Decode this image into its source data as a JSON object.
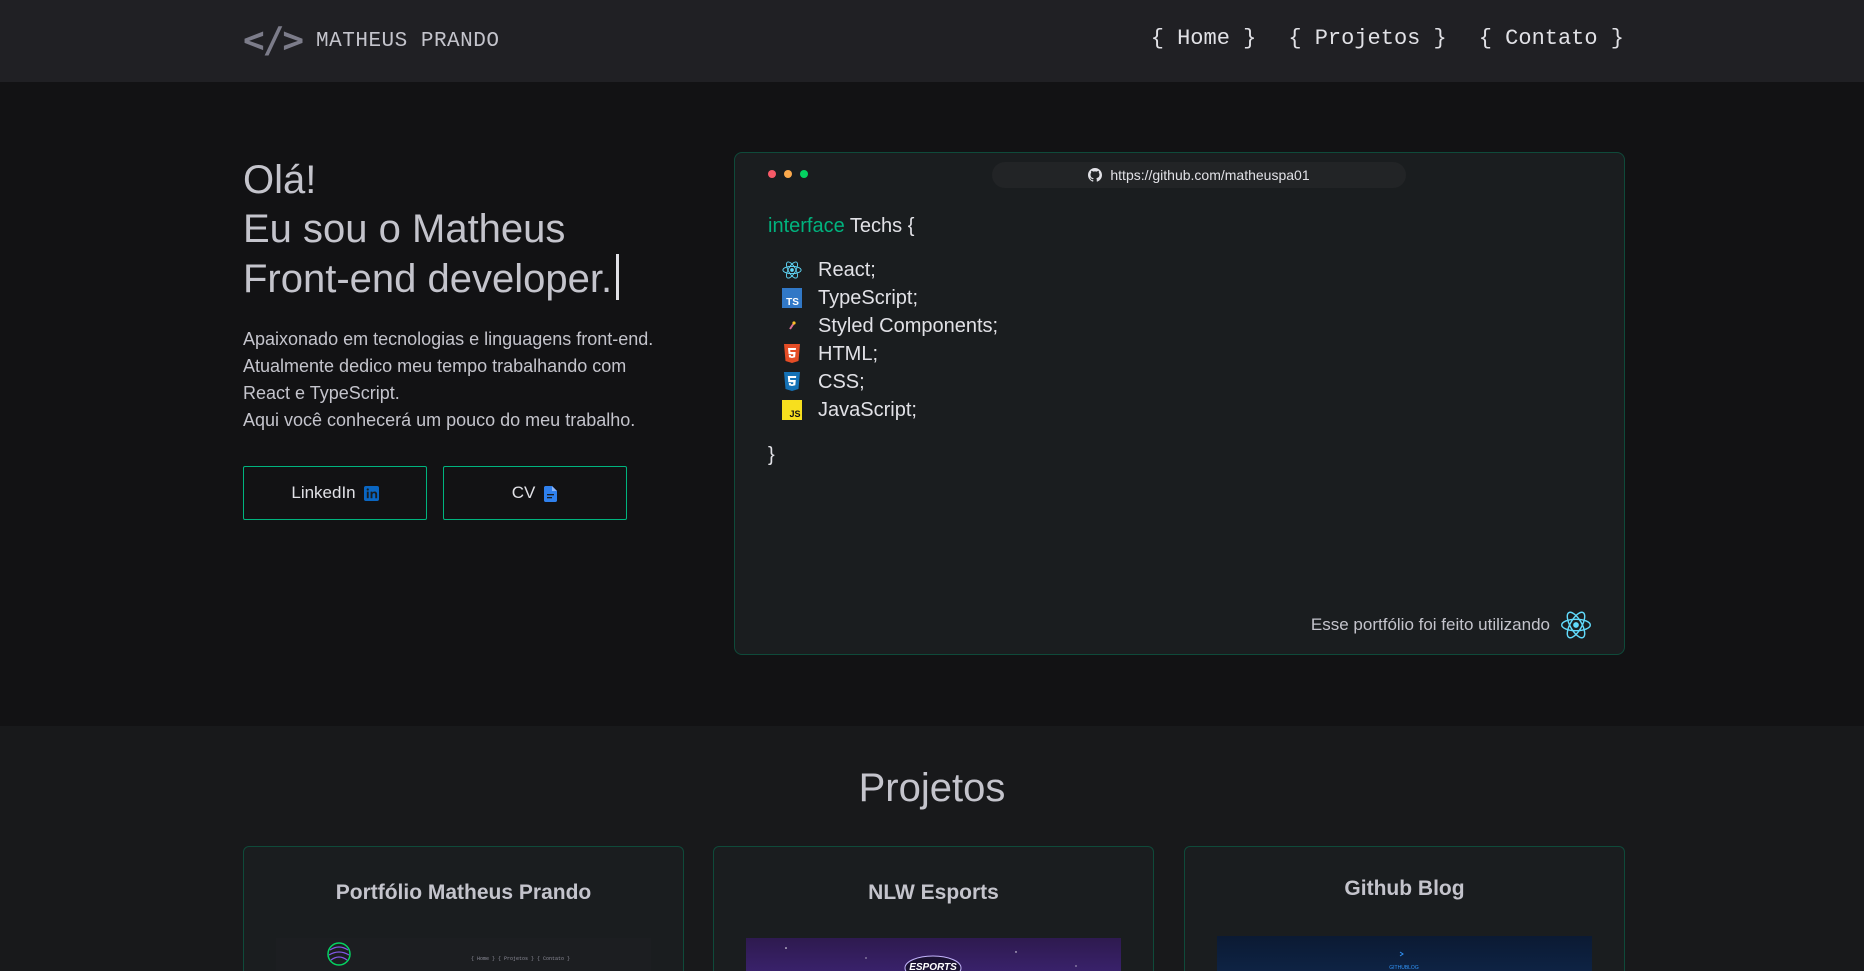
{
  "header": {
    "logo_mark": "</>",
    "name": "MATHEUS PRANDO",
    "nav": [
      "{ Home }",
      "{ Projetos }",
      "{ Contato }"
    ]
  },
  "hero": {
    "greeting": "Olá!",
    "line2": "Eu sou o Matheus",
    "line3": "Front-end developer.",
    "description": [
      "Apaixonado em tecnologias e linguagens front-end.",
      "Atualmente dedico meu tempo trabalhando com",
      "React e TypeScript.",
      "Aqui você conhecerá um pouco do meu trabalho."
    ],
    "buttons": {
      "linkedin": "LinkedIn",
      "cv": "CV"
    }
  },
  "code_card": {
    "url": "https://github.com/matheuspa01",
    "keyword": "interface",
    "type_name": "Techs {",
    "techs": [
      {
        "label": "React;",
        "icon": "react-icon"
      },
      {
        "label": "TypeScript;",
        "icon": "typescript-icon"
      },
      {
        "label": "Styled Components;",
        "icon": "styled-components-icon"
      },
      {
        "label": "HTML;",
        "icon": "html5-icon"
      },
      {
        "label": "CSS;",
        "icon": "css3-icon"
      },
      {
        "label": "JavaScript;",
        "icon": "javascript-icon"
      }
    ],
    "closing": "}",
    "footer": "Esse portfólio foi feito utilizando"
  },
  "projects": {
    "title": "Projetos",
    "items": [
      {
        "title": "Portfólio Matheus Prando",
        "thumb_nav": "{ Home }  { Projetos }  { Contato }"
      },
      {
        "title": "NLW Esports",
        "thumb_logo": "ESPORTS"
      },
      {
        "title": "Github Blog",
        "thumb_text": "GITHUBLOG"
      }
    ]
  },
  "colors": {
    "accent": "#00b37e",
    "background": "#121214",
    "header": "#202024",
    "card": "#1a1d1f"
  }
}
